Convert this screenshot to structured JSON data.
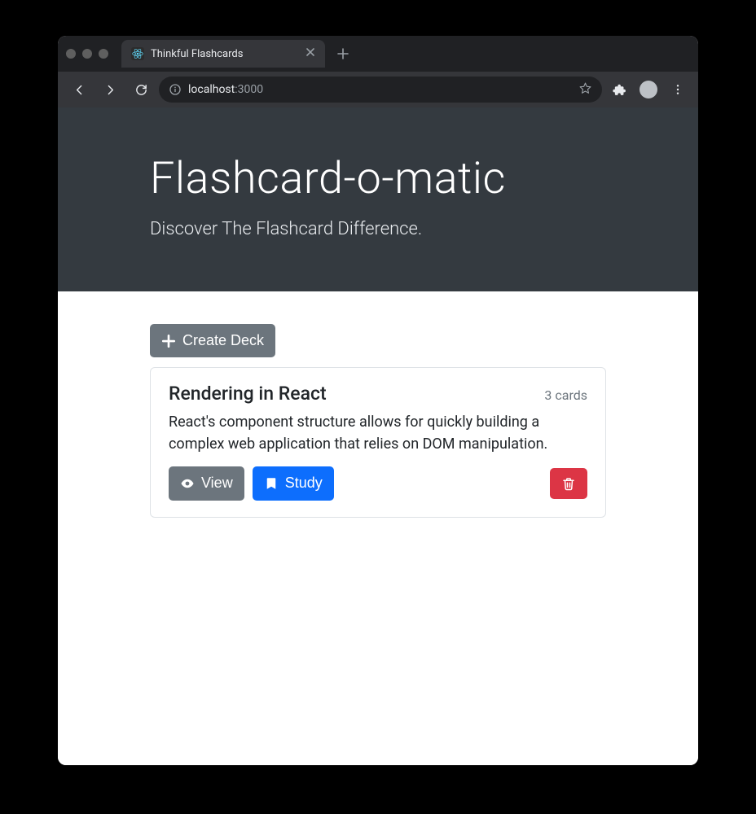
{
  "browser": {
    "tab_title": "Thinkful Flashcards",
    "url_host": "localhost",
    "url_port": ":3000"
  },
  "hero": {
    "title": "Flashcard-o-matic",
    "subtitle": "Discover The Flashcard Difference."
  },
  "actions": {
    "create_deck": "Create Deck"
  },
  "decks": [
    {
      "title": "Rendering in React",
      "count_label": "3 cards",
      "description": "React's component structure allows for quickly building a complex web application that relies on DOM manipulation.",
      "view_label": "View",
      "study_label": "Study"
    }
  ]
}
